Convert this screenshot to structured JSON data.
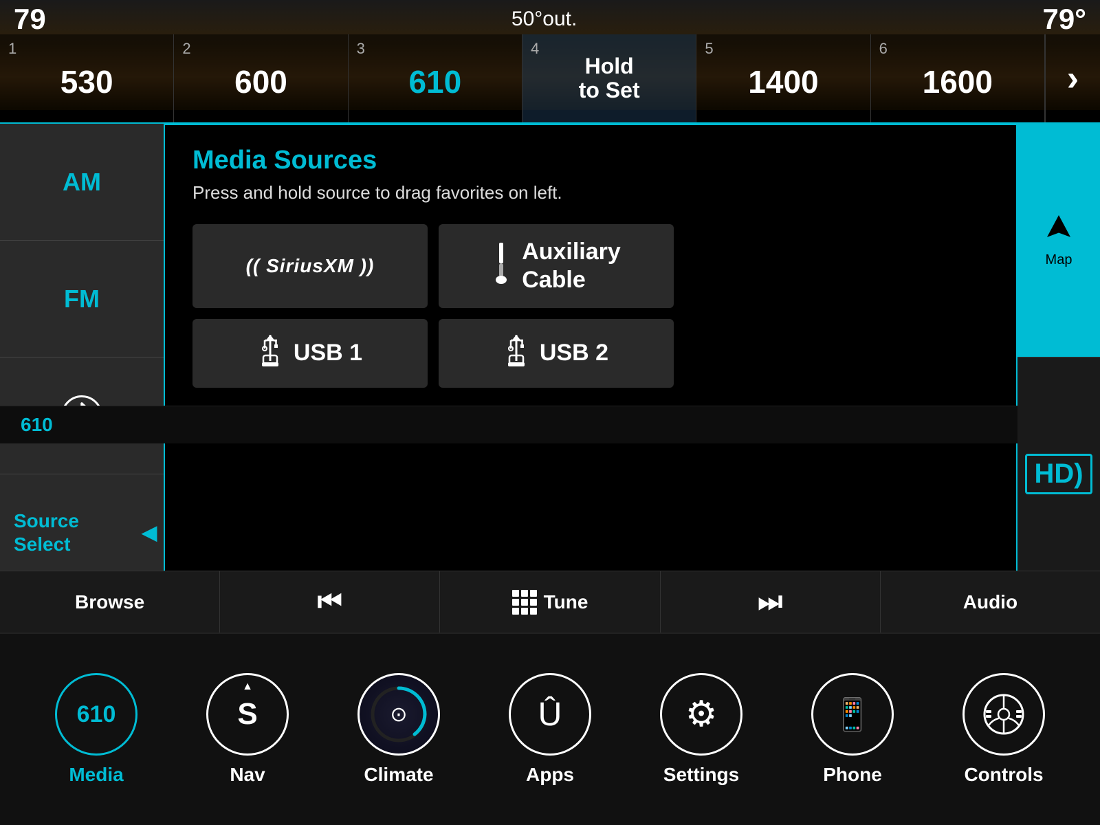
{
  "header": {
    "left_num": "79",
    "temp_out": "50°out.",
    "right_temp": "79°"
  },
  "presets": [
    {
      "num": "1",
      "freq": "530",
      "active": false
    },
    {
      "num": "2",
      "freq": "600",
      "active": false
    },
    {
      "num": "3",
      "freq": "610",
      "active": true
    },
    {
      "num": "4",
      "hold_label": "Hold\nto Set",
      "active": false
    },
    {
      "num": "5",
      "freq": "1400",
      "active": false
    },
    {
      "num": "6",
      "freq": "1600",
      "active": false
    }
  ],
  "sidebar": {
    "am_label": "AM",
    "fm_label": "FM",
    "source_label": "Source\nSelect"
  },
  "media_sources": {
    "title": "Media Sources",
    "subtitle": "Press and hold source to drag favorites on left.",
    "sources": [
      {
        "id": "siriusxm",
        "label": "((  SiriusXM  ))"
      },
      {
        "id": "aux",
        "icon": "🔌",
        "label": "Auxiliary\nCable"
      },
      {
        "id": "usb1",
        "icon": "⚡",
        "label": "USB 1"
      },
      {
        "id": "usb2",
        "icon": "⚡",
        "label": "USB 2"
      }
    ]
  },
  "right_nav": [
    {
      "id": "map",
      "label": "Map",
      "active": true
    },
    {
      "id": "hd",
      "label": "HD",
      "active": false
    }
  ],
  "transport": {
    "browse_label": "Browse",
    "prev_label": "⏮",
    "tune_label": "Tune",
    "next_label": "⏭",
    "audio_label": "Audio"
  },
  "bottom_nav": [
    {
      "id": "media",
      "label": "Media",
      "icon": "610",
      "active": true
    },
    {
      "id": "nav",
      "label": "Nav",
      "icon": "S",
      "active": false
    },
    {
      "id": "climate",
      "label": "Climate",
      "icon": "◎",
      "active": false
    },
    {
      "id": "apps",
      "label": "Apps",
      "icon": "Û",
      "active": false
    },
    {
      "id": "settings",
      "label": "Settings",
      "icon": "⚙",
      "active": false
    },
    {
      "id": "phone",
      "label": "Phone",
      "icon": "📱",
      "active": false
    },
    {
      "id": "controls",
      "label": "Controls",
      "icon": "🎛",
      "active": false
    }
  ]
}
